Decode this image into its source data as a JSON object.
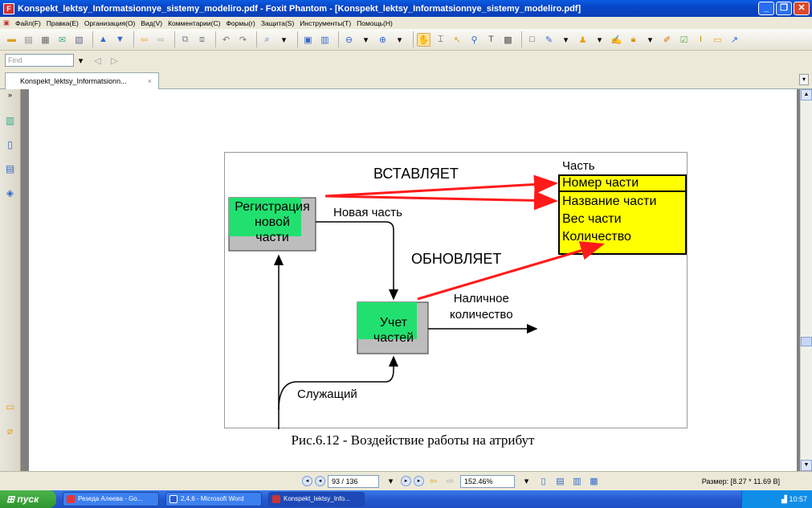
{
  "window": {
    "title": "Konspekt_lektsy_Informatsionnye_sistemy_modeliro.pdf - Foxit Phantom - [Konspekt_lektsy_Informatsionnye_sistemy_modeliro.pdf]"
  },
  "menu": [
    "Файл(F)",
    "Правка(E)",
    "Организация(O)",
    "Вид(V)",
    "Комментарии(C)",
    "Формы(r)",
    "Защита(S)",
    "Инструменты(T)",
    "Помощь(H)"
  ],
  "find": {
    "placeholder": "Find"
  },
  "tab": {
    "label": "Konspekt_lektsy_Informatsionn...",
    "close": "×"
  },
  "diagram": {
    "box_registration": [
      "Регистрация",
      "новой",
      "части"
    ],
    "box_accounting": [
      "Учет",
      "частей"
    ],
    "label_inserts": "ВСТАВЛЯЕТ",
    "label_updates": "ОБНОВЛЯЕТ",
    "label_new_part": "Новая часть",
    "label_available": [
      "Наличное",
      "количество"
    ],
    "label_employee": "Служащий",
    "entity_title": "Часть",
    "entity_key": "Номер части",
    "entity_attrs": [
      "Название части",
      "Вес части",
      "Количество"
    ]
  },
  "caption": "Рис.6.12 - Воздействие работы на атрибут",
  "status": {
    "page": "93 / 136",
    "zoom": "152.46%",
    "size": "Размер: [8.27 * 11.69 В]"
  },
  "taskbar": {
    "start": "пуск",
    "tasks": [
      "Резеда Алеева - Go...",
      "2,4,6 - Microsoft Word",
      "Konspekt_lektsy_Info..."
    ],
    "clock": "10:57"
  },
  "colors": {
    "accent_green": "#22e070",
    "entity_yellow": "#ffff00",
    "arrow_red": "#ff1a1a"
  }
}
